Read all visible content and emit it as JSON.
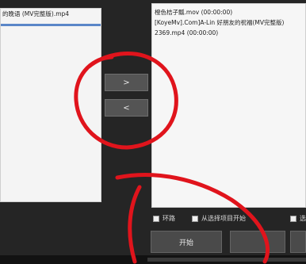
{
  "left_list": {
    "items": [
      "的晚语 (MV完整版).mp4"
    ]
  },
  "middle": {
    "add_label": ">",
    "remove_label": "<"
  },
  "right_list": {
    "items": [
      "橙色桔子瓢.mov  (00:00:00)",
      "[KoyeMv].Com]A-Lin 好朋友的祝福(MV完整版)",
      "2369.mp4  (00:00:00)"
    ]
  },
  "options": {
    "loop_label": "环路",
    "from_selected_label": "从选择项目开始",
    "third_label": "选"
  },
  "buttons": {
    "start_label": "开始",
    "second_label": "",
    "third_label": ""
  },
  "annotation_color": "#e0141c"
}
